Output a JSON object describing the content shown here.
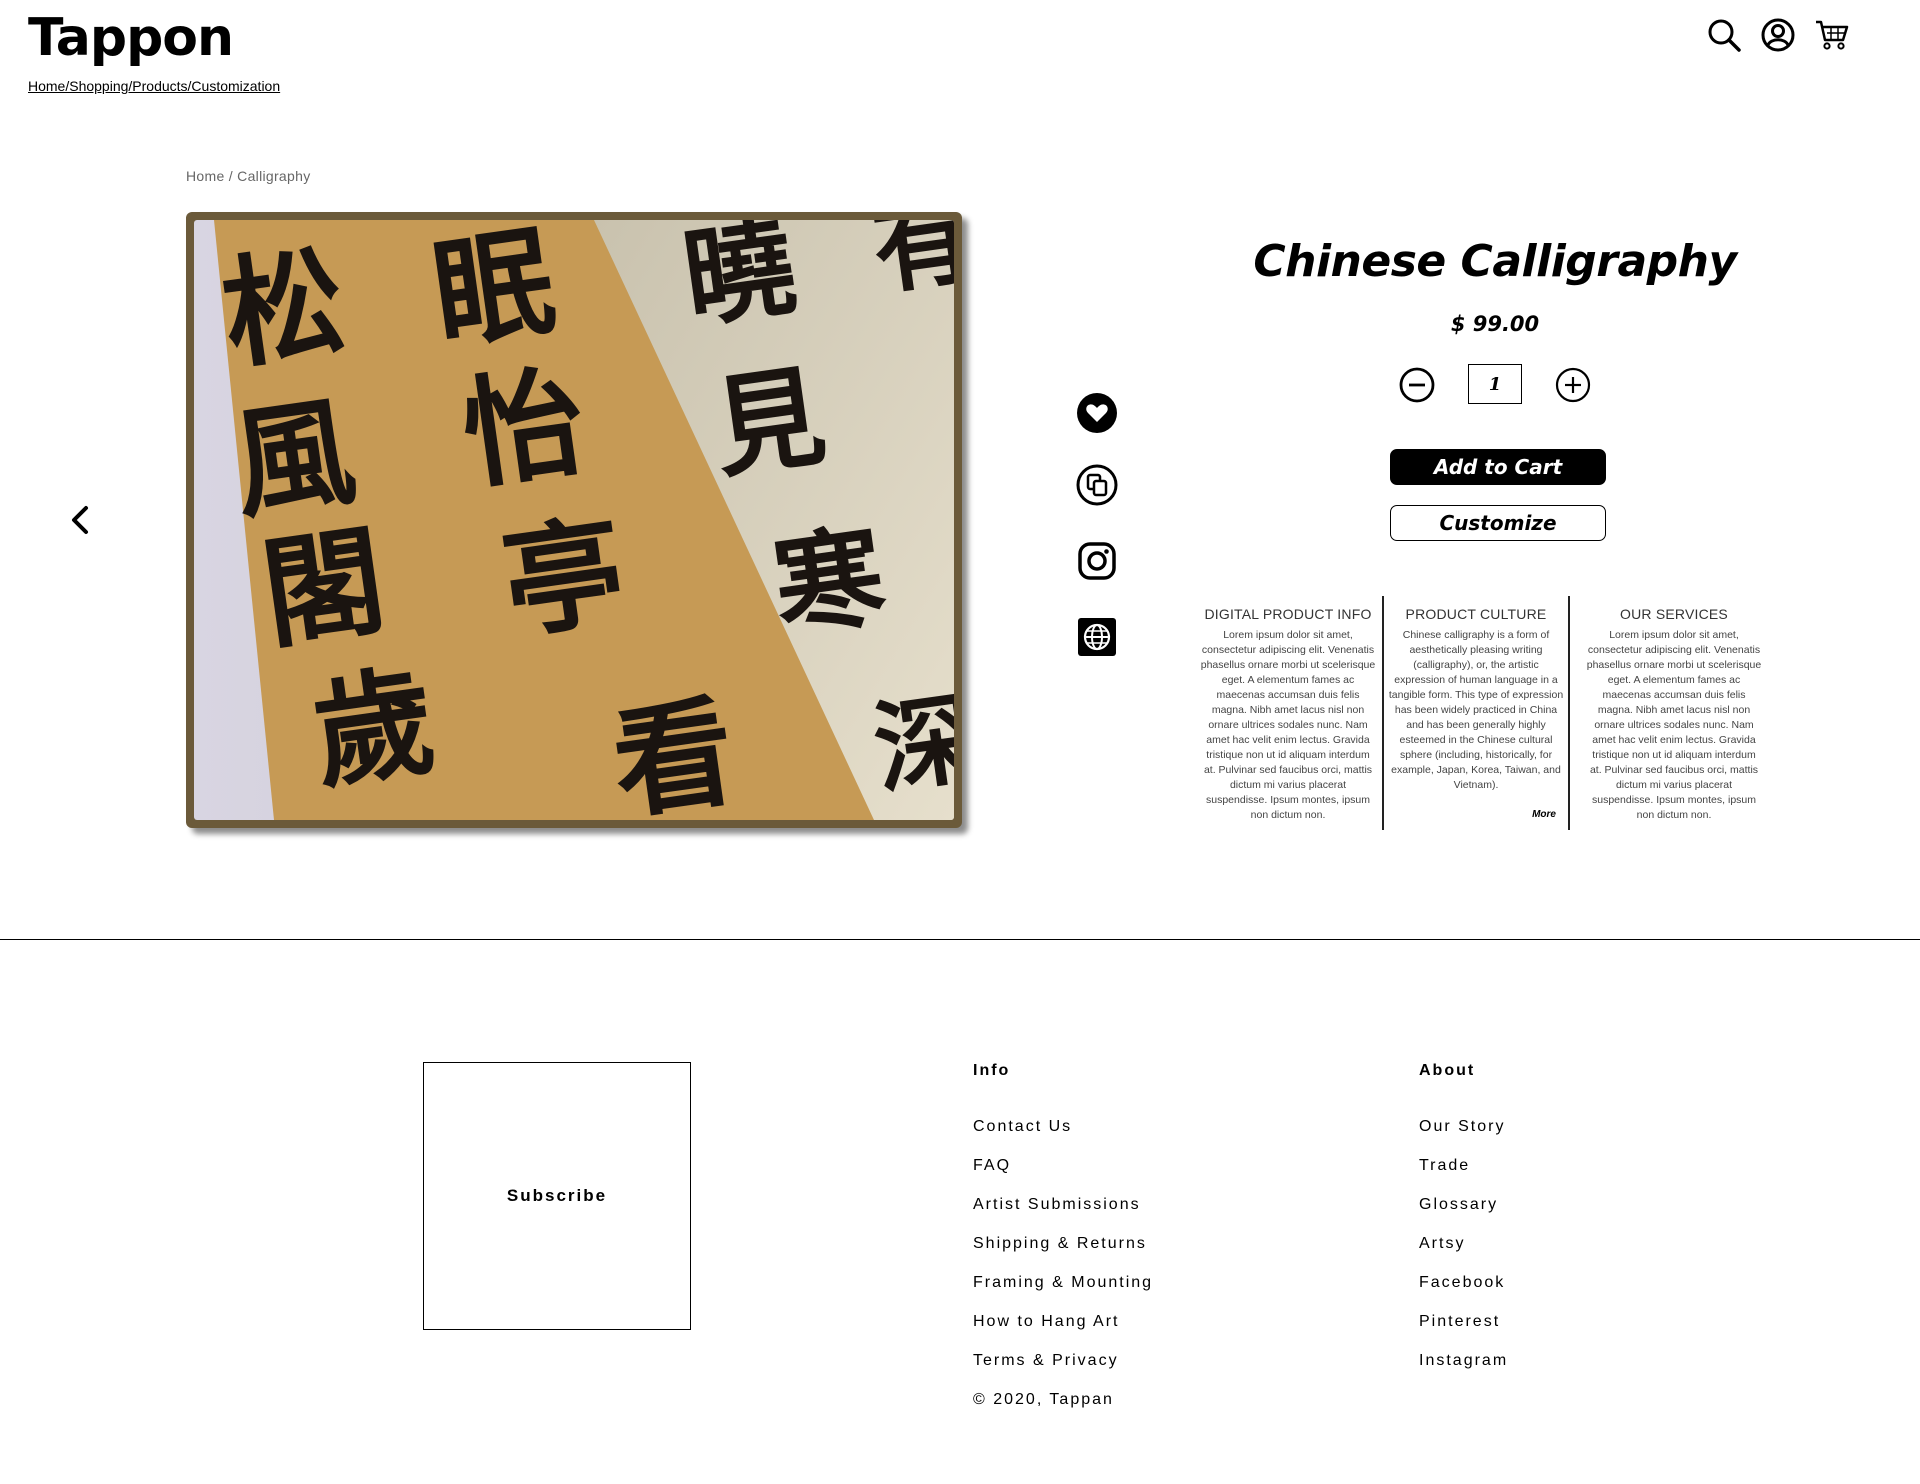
{
  "header": {
    "logo": "Tappon",
    "breadcrumb": "Home/Shopping/Products/Customization",
    "icons": [
      "search-icon",
      "account-icon",
      "cart-icon"
    ]
  },
  "breadcrumb": {
    "home": "Home",
    "separator": "/",
    "current": "Calligraphy"
  },
  "gallery": {
    "image_subject": "Chinese calligraphy scroll with black brush characters",
    "characters": [
      "松",
      "風",
      "閣",
      "歲",
      "眠",
      "怡",
      "亭",
      "曉",
      "見",
      "寒",
      "看",
      "有",
      "深"
    ]
  },
  "side_actions": [
    "heart-icon",
    "copy-icon",
    "instagram-icon",
    "globe-icon"
  ],
  "product": {
    "title": "Chinese Calligraphy",
    "price": "$ 99.00",
    "quantity": "1",
    "add_to_cart": "Add to Cart",
    "customize": "Customize"
  },
  "info_columns": [
    {
      "heading": "DIGITAL PRODUCT INFO",
      "body": "Lorem ipsum dolor sit amet, consectetur adipiscing elit. Venenatis phasellus ornare morbi ut scelerisque eget. A elementum fames ac maecenas accumsan duis felis magna. Nibh amet lacus nisl non ornare ultrices sodales nunc. Nam amet hac velit enim lectus. Gravida tristique non ut id aliquam interdum at. Pulvinar sed faucibus orci, mattis dictum mi varius placerat suspendisse. Ipsum montes, ipsum non dictum non."
    },
    {
      "heading": "PRODUCT CULTURE",
      "body": "Chinese calligraphy is a form of aesthetically pleasing writing (calligraphy), or, the artistic expression of human language in a tangible form. This type of expression has been widely practiced in China and has been generally highly esteemed in the Chinese cultural sphere (including, historically, for example, Japan, Korea, Taiwan, and Vietnam).",
      "more": "More"
    },
    {
      "heading": "OUR SERVICES",
      "body": "Lorem ipsum dolor sit amet, consectetur adipiscing elit. Venenatis phasellus ornare morbi ut scelerisque eget. A elementum fames ac maecenas accumsan duis felis magna. Nibh amet lacus nisl non ornare ultrices sodales nunc. Nam amet hac velit enim lectus. Gravida tristique non ut id aliquam interdum at. Pulvinar sed faucibus orci, mattis dictum mi varius placerat suspendisse. Ipsum montes, ipsum non dictum non."
    }
  ],
  "footer": {
    "subscribe": "Subscribe",
    "info": {
      "heading": "Info",
      "links": [
        "Contact Us",
        "FAQ",
        "Artist Submissions",
        "Shipping & Returns",
        "Framing & Mounting",
        "How to Hang Art",
        "Terms & Privacy"
      ],
      "copyright": "© 2020, Tappan"
    },
    "about": {
      "heading": "About",
      "links": [
        "Our Story",
        "Trade",
        "Glossary",
        "Artsy",
        "Facebook",
        "Pinterest",
        "Instagram"
      ]
    }
  }
}
